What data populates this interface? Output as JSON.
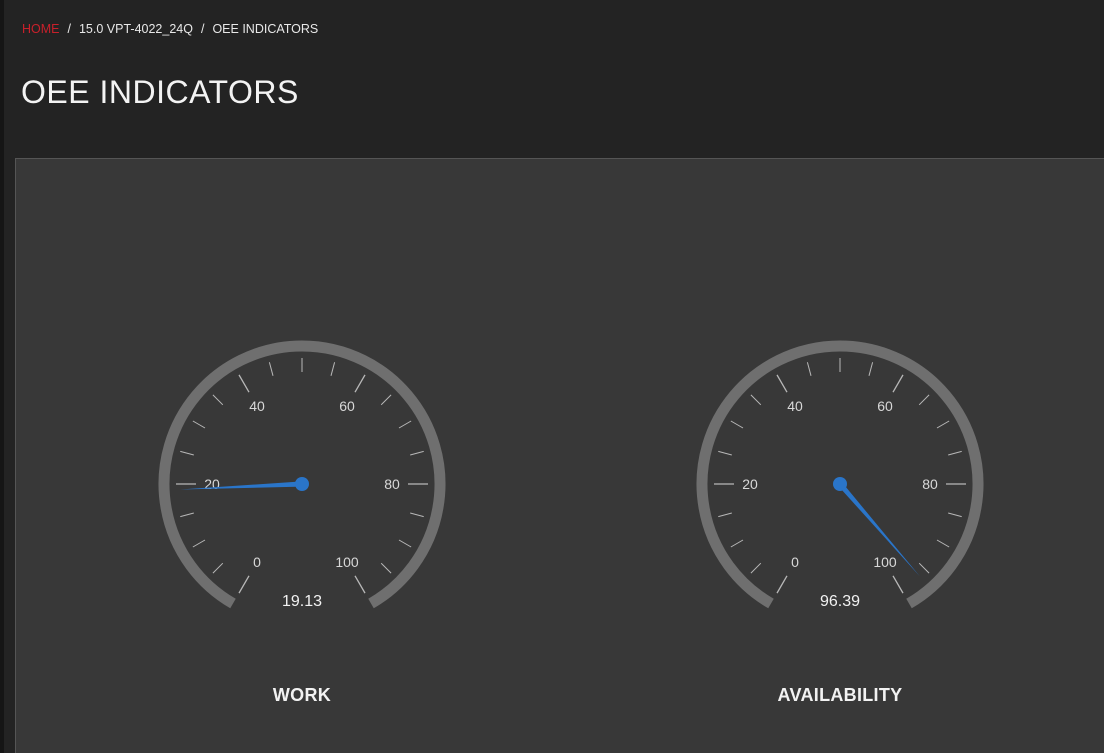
{
  "breadcrumb": {
    "home": "HOME",
    "separator": "/",
    "machine": "15.0 VPT-4022_24Q",
    "current": "OEE INDICATORS"
  },
  "page": {
    "title": "OEE INDICATORS"
  },
  "gauges": [
    {
      "label": "WORK",
      "value": 19.13,
      "value_text": "19.13",
      "min": 0,
      "max": 100,
      "tick_labels": [
        "0",
        "20",
        "40",
        "60",
        "80",
        "100"
      ]
    },
    {
      "label": "AVAILABILITY",
      "value": 96.39,
      "value_text": "96.39",
      "min": 0,
      "max": 100,
      "tick_labels": [
        "0",
        "20",
        "40",
        "60",
        "80",
        "100"
      ]
    }
  ],
  "colors": {
    "background": "#232323",
    "panel": "#383838",
    "gauge_arc": "#6f6f6f",
    "ticks": "#b8b8b8",
    "needle": "#2a75c9",
    "home_link": "#c8202b",
    "text": "#f2f2f2"
  }
}
